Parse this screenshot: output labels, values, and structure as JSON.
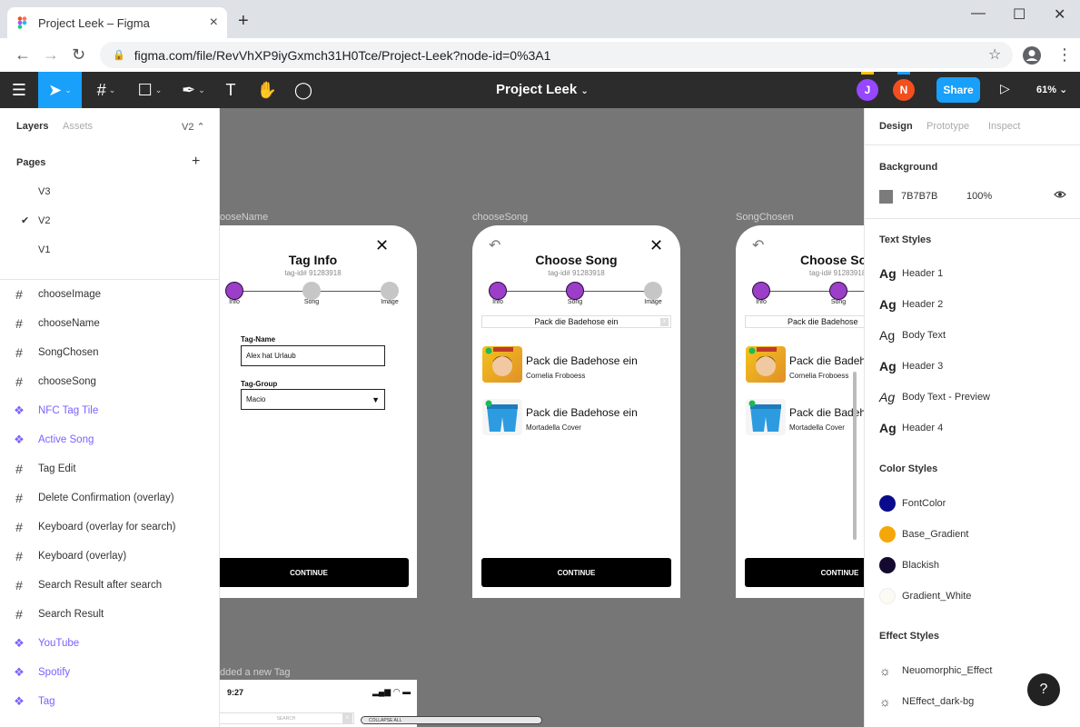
{
  "browser": {
    "tab_title": "Project Leek – Figma",
    "tab_close": "×",
    "new_tab": "+",
    "url": "figma.com/file/RevVhXP9iyGxmch31H0Tce/Project-Leek?node-id=0%3A1",
    "min": "—",
    "max": "☐",
    "close": "✕"
  },
  "toolbar": {
    "project_name": "Project Leek",
    "avatars": [
      {
        "letter": "J",
        "color": "#9747ff"
      },
      {
        "letter": "N",
        "color": "#f24e1e"
      }
    ],
    "share_label": "Share",
    "zoom": "61%"
  },
  "left": {
    "tabs": {
      "layers": "Layers",
      "assets": "Assets",
      "page": "V2"
    },
    "pages_header": "Pages",
    "pages": [
      {
        "label": "V3",
        "checked": false
      },
      {
        "label": "V2",
        "checked": true
      },
      {
        "label": "V1",
        "checked": false
      }
    ],
    "layers": [
      {
        "label": "chooseImage",
        "type": "frame"
      },
      {
        "label": "chooseName",
        "type": "frame"
      },
      {
        "label": "SongChosen",
        "type": "frame"
      },
      {
        "label": "chooseSong",
        "type": "frame"
      },
      {
        "label": "NFC Tag Tile",
        "type": "component"
      },
      {
        "label": "Active Song",
        "type": "component"
      },
      {
        "label": "Tag Edit",
        "type": "frame"
      },
      {
        "label": "Delete Confirmation (overlay)",
        "type": "frame"
      },
      {
        "label": "Keyboard (overlay for search)",
        "type": "frame"
      },
      {
        "label": "Keyboard (overlay)",
        "type": "frame"
      },
      {
        "label": "Search Result after search",
        "type": "frame"
      },
      {
        "label": "Search Result",
        "type": "frame"
      },
      {
        "label": "YouTube",
        "type": "component"
      },
      {
        "label": "Spotify",
        "type": "component"
      },
      {
        "label": "Tag",
        "type": "component"
      }
    ]
  },
  "canvas": {
    "background": "#767676",
    "frame_labels": {
      "choose_name": "ooseName",
      "choose_song": "chooseSong",
      "song_chosen": "SongChosen",
      "added_tag": "dded a new Tag"
    },
    "steps": [
      "Info",
      "Song",
      "Image"
    ],
    "tag_id": "tag-id# 91283918",
    "choose_name": {
      "title": "Tag Info",
      "name_label": "Tag-Name",
      "name_value": "Alex hat Urlaub",
      "group_label": "Tag-Group",
      "group_value": "Macio",
      "continue": "CONTINUE"
    },
    "choose_song": {
      "title": "Choose Song",
      "search_value": "Pack die Badehose ein",
      "songs": [
        {
          "title": "Pack die Badehose ein",
          "artist": "Cornelia Froboess"
        },
        {
          "title": "Pack die Badehose ein",
          "artist": "Mortadella Cover"
        }
      ],
      "continue": "CONTINUE"
    },
    "song_chosen": {
      "title": "Choose So",
      "search_value": "Pack die Badehose",
      "songs": [
        {
          "title": "Pack die Badeh",
          "artist": "Cornelia Froboess"
        },
        {
          "title": "Pack die Badeh",
          "artist": "Mortadella Cover"
        }
      ],
      "continue": "CONTINUE"
    },
    "bottom_frame": {
      "time": "9:27",
      "search": "SEARCH",
      "collapse": "COLLAPSE ALL"
    }
  },
  "right": {
    "tabs": {
      "design": "Design",
      "prototype": "Prototype",
      "inspect": "Inspect"
    },
    "background_header": "Background",
    "bg_hex": "7B7B7B",
    "bg_opacity": "100%",
    "text_styles_header": "Text Styles",
    "text_styles": [
      {
        "label": "Header 1",
        "bold": true,
        "italic": false
      },
      {
        "label": "Header 2",
        "bold": true,
        "italic": false
      },
      {
        "label": "Body Text",
        "bold": false,
        "italic": false
      },
      {
        "label": "Header 3",
        "bold": true,
        "italic": false
      },
      {
        "label": "Body Text - Preview",
        "bold": false,
        "italic": true
      },
      {
        "label": "Header 4",
        "bold": true,
        "italic": false
      }
    ],
    "ag": "Ag",
    "color_styles_header": "Color Styles",
    "color_styles": [
      {
        "label": "FontColor",
        "color": "#0a0a8c"
      },
      {
        "label": "Base_Gradient",
        "color": "#f5a70a"
      },
      {
        "label": "Blackish",
        "color": "#140a30"
      },
      {
        "label": "Gradient_White",
        "color": "#fbfbf4"
      }
    ],
    "effect_styles_header": "Effect Styles",
    "effect_styles": [
      {
        "label": "Neuomorphic_Effect"
      },
      {
        "label": "NEffect_dark-bg"
      }
    ]
  },
  "help": "?"
}
